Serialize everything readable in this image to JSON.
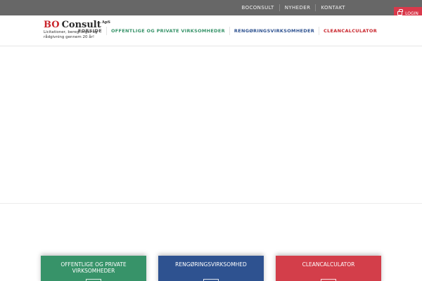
{
  "topbar": {
    "links": [
      "BOCONSULT",
      "NYHEDER",
      "KONTAKT"
    ],
    "login_label": "LOGIN"
  },
  "logo": {
    "bo": "BO",
    "consult": "Consult",
    "aps": "ApS",
    "tagline": "Licitationer, beregninger og rådgivning gennem 20 år!"
  },
  "nav": {
    "items": [
      {
        "label": "FORSIDE",
        "color": "#555555"
      },
      {
        "label": "OFFENTLIGE OG PRIVATE VIRKSOMHEDER",
        "color": "#379369"
      },
      {
        "label": "RENGØRINGSVIRKSOMHEDER",
        "color": "#2e5290"
      },
      {
        "label": "CLEANCALCULATOR",
        "color": "#c9252c"
      }
    ]
  },
  "boxes": [
    {
      "title": "OFFENTLIGE OG PRIVATE VIRKSOMHEDER",
      "color": "#379369",
      "icon": "building-icon"
    },
    {
      "title": "RENGØRINGSVIRKSOMHED",
      "color": "#2e5290",
      "icon": "calculator-icon"
    },
    {
      "title": "CLEANCALCULATOR",
      "color": "#d33e4a",
      "icon": "document-icon"
    }
  ]
}
